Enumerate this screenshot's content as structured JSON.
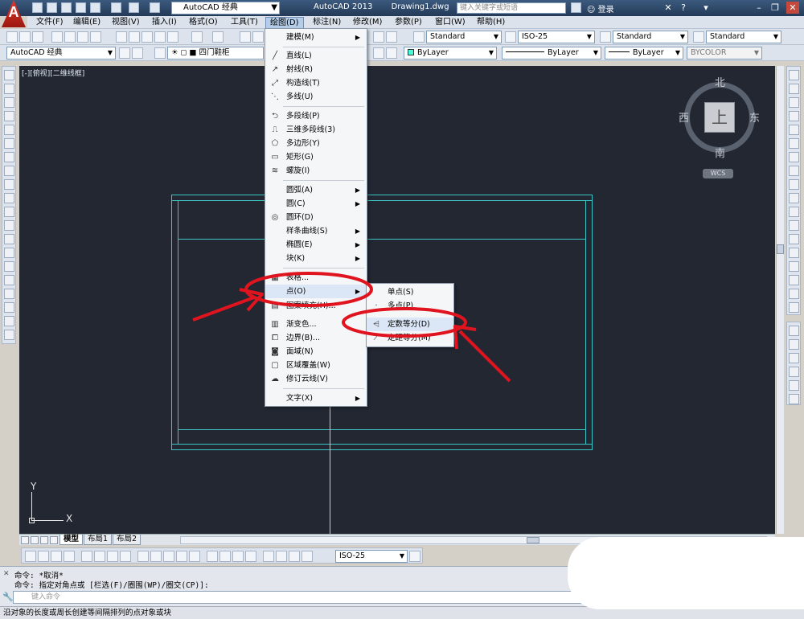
{
  "titlebar": {
    "workspace": "AutoCAD 经典",
    "app_name": "AutoCAD 2013",
    "document": "Drawing1.dwg",
    "search_placeholder": "键入关键字或短语",
    "login": "登录",
    "help": "?"
  },
  "menubar": {
    "items": [
      "文件(F)",
      "编辑(E)",
      "视图(V)",
      "插入(I)",
      "格式(O)",
      "工具(T)",
      "绘图(D)",
      "标注(N)",
      "修改(M)",
      "参数(P)",
      "窗口(W)",
      "帮助(H)"
    ]
  },
  "toolbar1": {
    "text_style": "Standard",
    "dim_style": "ISO-25",
    "table_style": "Standard",
    "mleader_style": "Standard"
  },
  "toolbar2": {
    "workspace": "AutoCAD 经典",
    "layer_button": "四门鞋柜",
    "color": "ByLayer",
    "linetype": "ByLayer",
    "lineweight": "ByLayer",
    "plotstyle": "BYCOLOR"
  },
  "canvas": {
    "viewport_label": "[-][俯视][二维线框]",
    "compass": {
      "north": "北",
      "south": "南",
      "east": "东",
      "west": "西",
      "top": "上"
    },
    "wcs": "WCS",
    "ucs_x": "X",
    "ucs_y": "Y"
  },
  "draw_menu": {
    "items": [
      {
        "label": "建模(M)",
        "icon": "modeling-icon",
        "sub": true
      },
      {
        "label": "直线(L)",
        "icon": "line-icon",
        "sub": false
      },
      {
        "label": "射线(R)",
        "icon": "ray-icon",
        "sub": false
      },
      {
        "label": "构造线(T)",
        "icon": "xline-icon",
        "sub": false
      },
      {
        "label": "多线(U)",
        "icon": "mline-icon",
        "sub": false
      },
      {
        "label": "多段线(P)",
        "icon": "pline-icon",
        "sub": false
      },
      {
        "label": "三维多段线(3)",
        "icon": "3dpoly-icon",
        "sub": false
      },
      {
        "label": "多边形(Y)",
        "icon": "polygon-icon",
        "sub": false
      },
      {
        "label": "矩形(G)",
        "icon": "rectangle-icon",
        "sub": false
      },
      {
        "label": "螺旋(I)",
        "icon": "helix-icon",
        "sub": false
      },
      {
        "label": "圆弧(A)",
        "icon": "arc-icon",
        "sub": true
      },
      {
        "label": "圆(C)",
        "icon": "circle-icon",
        "sub": true
      },
      {
        "label": "圆环(D)",
        "icon": "donut-icon",
        "sub": false
      },
      {
        "label": "样条曲线(S)",
        "icon": "spline-icon",
        "sub": true
      },
      {
        "label": "椭圆(E)",
        "icon": "ellipse-icon",
        "sub": true
      },
      {
        "label": "块(K)",
        "icon": "block-icon",
        "sub": true
      },
      {
        "label": "表格...",
        "icon": "table-icon",
        "sub": false
      },
      {
        "label": "点(O)",
        "icon": "point-icon",
        "sub": true
      },
      {
        "label": "图案填充(H)...",
        "icon": "hatch-icon",
        "sub": false
      },
      {
        "label": "渐变色...",
        "icon": "gradient-icon",
        "sub": false
      },
      {
        "label": "边界(B)...",
        "icon": "boundary-icon",
        "sub": false
      },
      {
        "label": "面域(N)",
        "icon": "region-icon",
        "sub": false
      },
      {
        "label": "区域覆盖(W)",
        "icon": "wipeout-icon",
        "sub": false
      },
      {
        "label": "修订云线(V)",
        "icon": "revcloud-icon",
        "sub": false
      },
      {
        "label": "文字(X)",
        "icon": "text-icon",
        "sub": true
      }
    ]
  },
  "point_submenu": {
    "items": [
      "单点(S)",
      "多点(P)",
      "定数等分(D)",
      "定距等分(M)"
    ]
  },
  "layout_tabs": [
    "模型",
    "布局1",
    "布局2"
  ],
  "bottom_toolbar": {
    "dim_style": "ISO-25"
  },
  "command": {
    "line1": "命令: *取消*",
    "line2": "命令: 指定对角点或 [栏选(F)/圈围(WP)/圈交(CP)]:",
    "input_placeholder": "键入命令"
  },
  "statusbar": {
    "text": "沿对象的长度或周长创建等间隔排列的点对象或块"
  },
  "colors": {
    "canvas_bg": "#222732",
    "geometry": "#39c6c6",
    "annotation": "#e0141e"
  }
}
